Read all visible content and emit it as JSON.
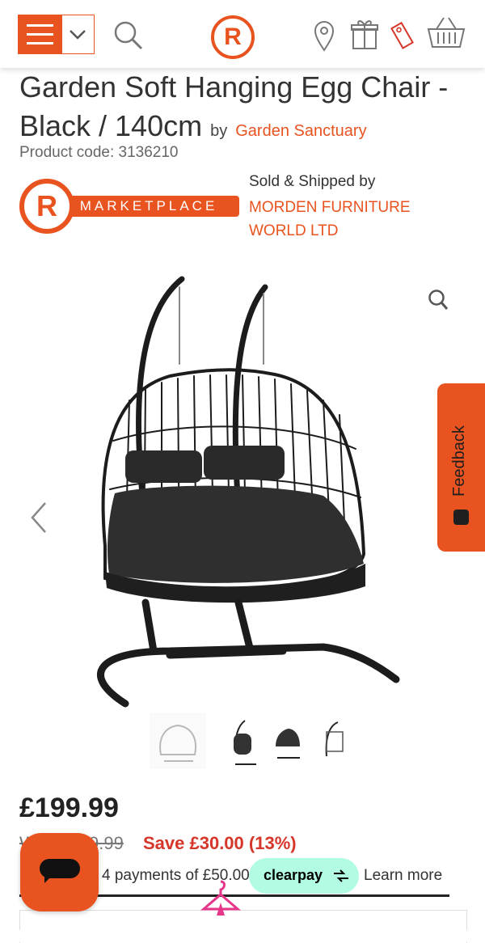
{
  "header": {
    "logo_letter": "R",
    "icons": [
      "menu-icon",
      "chevron-down-icon",
      "search-icon",
      "location-pin-icon",
      "gift-icon",
      "tag-icon",
      "basket-icon"
    ]
  },
  "product": {
    "title": "Garden Soft Hanging Egg Chair - Black / 140cm",
    "by": "by",
    "brand": "Garden Sanctuary",
    "code": "Product code: 3136210"
  },
  "marketplace": {
    "logo_letter": "R",
    "badge_text": "MARKETPLACE",
    "sold_label": "Sold & Shipped by",
    "seller": "MORDEN FURNITURE WORLD LTD"
  },
  "feedback": {
    "label": "Feedback"
  },
  "pricing": {
    "price": "£199.99",
    "was": "Was £229.99",
    "save": "Save £30.00 (13%)"
  },
  "payment": {
    "text": "4 payments of £50.00 with",
    "provider": "clearpay",
    "learn_more": "Learn more"
  },
  "colors": {
    "accent": "#e8531f",
    "save": "#d6362a",
    "clearpay": "#b2fce4"
  }
}
